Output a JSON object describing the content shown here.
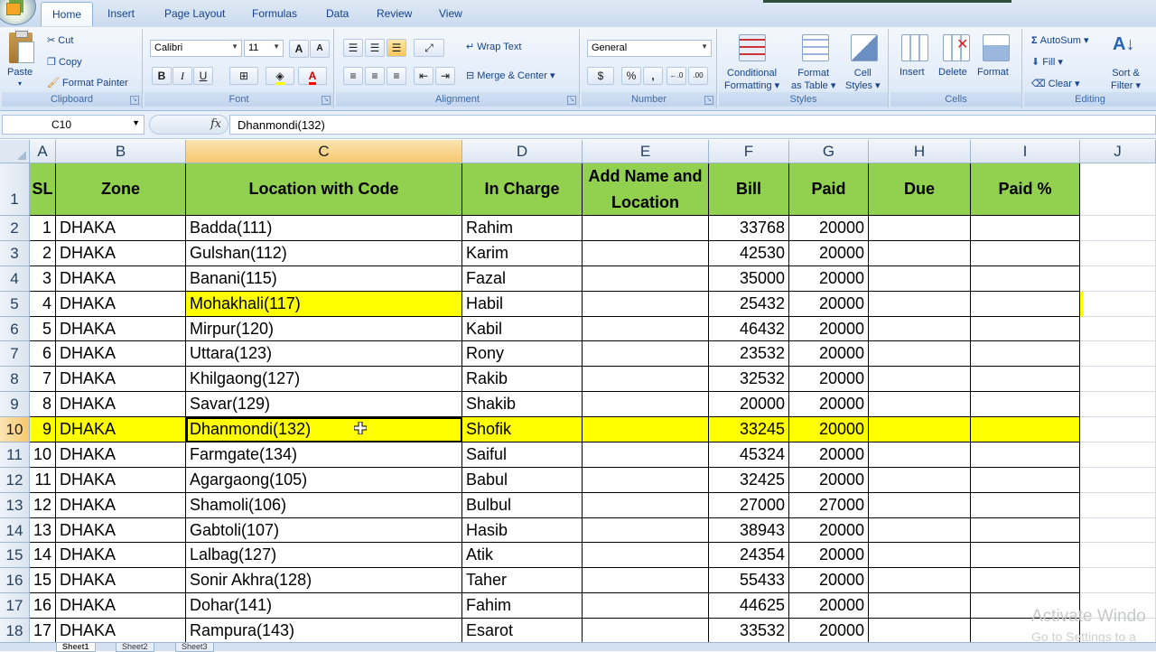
{
  "tabs": [
    "Home",
    "Insert",
    "Page Layout",
    "Formulas",
    "Data",
    "Review",
    "View"
  ],
  "clipboard": {
    "paste": "Paste",
    "cut": "Cut",
    "copy": "Copy",
    "format_painter": "Format Painter",
    "label": "Clipboard"
  },
  "font": {
    "name": "Calibri",
    "size": "11",
    "label": "Font",
    "bold": "B",
    "italic": "I",
    "underline": "U",
    "grow": "A",
    "shrink": "A"
  },
  "alignment": {
    "wrap": "Wrap Text",
    "merge": "Merge & Center",
    "label": "Alignment"
  },
  "number": {
    "format": "General",
    "currency": "$",
    "percent": "%",
    "comma": ",",
    "inc_dec": "←.0 .00",
    "dec_dec": ".00 →.0",
    "label": "Number"
  },
  "styles": {
    "conditional": "Conditional",
    "conditional2": "Formatting",
    "format_table": "Format",
    "format_table2": "as Table",
    "cell": "Cell",
    "cell2": "Styles",
    "label": "Styles"
  },
  "cells": {
    "insert": "Insert",
    "delete": "Delete",
    "format": "Format",
    "label": "Cells"
  },
  "editing": {
    "autosum": "AutoSum",
    "fill": "Fill",
    "clear": "Clear",
    "sort": "Sort &",
    "filter": "Filter",
    "label": "Editing"
  },
  "formula_bar": {
    "name_box": "C10",
    "fx": "fx",
    "content": "Dhanmondi(132)"
  },
  "columns": [
    "A",
    "B",
    "C",
    "D",
    "E",
    "F",
    "G",
    "H",
    "I",
    "J"
  ],
  "header_row": [
    "SL",
    "Zone",
    "Location with Code",
    "In Charge",
    "Add Name and Location",
    "Bill",
    "Paid",
    "Due",
    "Paid %"
  ],
  "rows": [
    {
      "sl": "1",
      "zone": "DHAKA",
      "loc": "Badda(111)",
      "incharge": "Rahim",
      "bill": "33768",
      "paid": "20000"
    },
    {
      "sl": "2",
      "zone": "DHAKA",
      "loc": "Gulshan(112)",
      "incharge": "Karim",
      "bill": "42530",
      "paid": "20000"
    },
    {
      "sl": "3",
      "zone": "DHAKA",
      "loc": "Banani(115)",
      "incharge": "Fazal",
      "bill": "35000",
      "paid": "20000"
    },
    {
      "sl": "4",
      "zone": "DHAKA",
      "loc": "Mohakhali(117)",
      "incharge": "Habil",
      "bill": "25432",
      "paid": "20000"
    },
    {
      "sl": "5",
      "zone": "DHAKA",
      "loc": "Mirpur(120)",
      "incharge": "Kabil",
      "bill": "46432",
      "paid": "20000"
    },
    {
      "sl": "6",
      "zone": "DHAKA",
      "loc": "Uttara(123)",
      "incharge": "Rony",
      "bill": "23532",
      "paid": "20000"
    },
    {
      "sl": "7",
      "zone": "DHAKA",
      "loc": "Khilgaong(127)",
      "incharge": "Rakib",
      "bill": "32532",
      "paid": "20000"
    },
    {
      "sl": "8",
      "zone": "DHAKA",
      "loc": "Savar(129)",
      "incharge": "Shakib",
      "bill": "20000",
      "paid": "20000"
    },
    {
      "sl": "9",
      "zone": "DHAKA",
      "loc": "Dhanmondi(132)",
      "incharge": "Shofik",
      "bill": "33245",
      "paid": "20000"
    },
    {
      "sl": "10",
      "zone": "DHAKA",
      "loc": "Farmgate(134)",
      "incharge": "Saiful",
      "bill": "45324",
      "paid": "20000"
    },
    {
      "sl": "11",
      "zone": "DHAKA",
      "loc": "Agargaong(105)",
      "incharge": "Babul",
      "bill": "32425",
      "paid": "20000"
    },
    {
      "sl": "12",
      "zone": "DHAKA",
      "loc": "Shamoli(106)",
      "incharge": "Bulbul",
      "bill": "27000",
      "paid": "27000"
    },
    {
      "sl": "13",
      "zone": "DHAKA",
      "loc": "Gabtoli(107)",
      "incharge": "Hasib",
      "bill": "38943",
      "paid": "20000"
    },
    {
      "sl": "14",
      "zone": "DHAKA",
      "loc": "Lalbag(127)",
      "incharge": "Atik",
      "bill": "24354",
      "paid": "20000"
    },
    {
      "sl": "15",
      "zone": "DHAKA",
      "loc": "Sonir Akhra(128)",
      "incharge": "Taher",
      "bill": "55433",
      "paid": "20000"
    },
    {
      "sl": "16",
      "zone": "DHAKA",
      "loc": "Dohar(141)",
      "incharge": "Fahim",
      "bill": "44625",
      "paid": "20000"
    },
    {
      "sl": "17",
      "zone": "DHAKA",
      "loc": "Rampura(143)",
      "incharge": "Esarot",
      "bill": "33532",
      "paid": "20000"
    }
  ],
  "row_numbers": [
    "1",
    "2",
    "3",
    "4",
    "5",
    "6",
    "7",
    "8",
    "9",
    "10",
    "11",
    "12",
    "13",
    "14",
    "15",
    "16",
    "17",
    "18"
  ],
  "selected_row": "10",
  "highlighted_rows": [
    "5",
    "10"
  ],
  "sheet_tabs": [
    "Sheet1",
    "Sheet2",
    "Sheet3"
  ],
  "watermark": {
    "line1": "Activate Windo",
    "line2": "Go to Settings to a"
  },
  "colors": {
    "header_green": "#92d050",
    "highlight_yellow": "#ffff00",
    "ribbon_blue": "#15428b"
  }
}
